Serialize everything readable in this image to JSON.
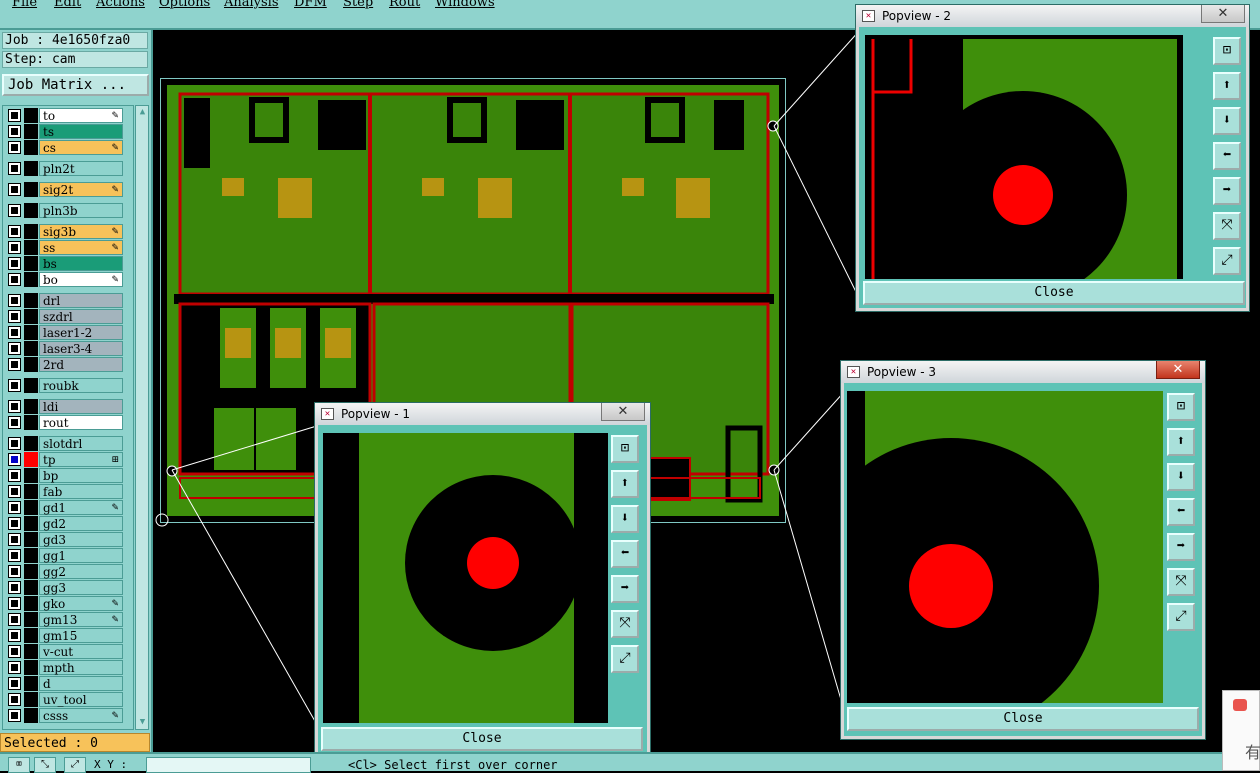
{
  "menu": [
    "File",
    "Edit",
    "Actions",
    "Options",
    "Analysis",
    "DFM",
    "Step",
    "Rout",
    "Windows"
  ],
  "job": {
    "job_line": "Job : 4e1650fza0",
    "step_line": "Step: cam",
    "matrix_button": "Job Matrix ..."
  },
  "layers": [
    {
      "name": "to",
      "bg": "#ffffff",
      "mark": "✎",
      "check": "off",
      "swatch": "#000000"
    },
    {
      "name": "ts",
      "bg": "#1a9c78",
      "mark": "",
      "check": "off",
      "swatch": "#000000"
    },
    {
      "name": "cs",
      "bg": "#f7c25a",
      "mark": "✎",
      "check": "off",
      "swatch": "#000000"
    },
    {
      "name": "pln2t",
      "bg": "#8fd3cd",
      "mark": "",
      "check": "off",
      "swatch": "#000000"
    },
    {
      "name": "sig2t",
      "bg": "#f7c25a",
      "mark": "✎",
      "check": "off",
      "swatch": "#000000"
    },
    {
      "name": "pln3b",
      "bg": "#8fd3cd",
      "mark": "",
      "check": "off",
      "swatch": "#000000"
    },
    {
      "name": "sig3b",
      "bg": "#f7c25a",
      "mark": "✎",
      "check": "off",
      "swatch": "#000000"
    },
    {
      "name": "ss",
      "bg": "#f7c25a",
      "mark": "✎",
      "check": "off",
      "swatch": "#000000"
    },
    {
      "name": "bs",
      "bg": "#1a9c78",
      "mark": "",
      "check": "off",
      "swatch": "#000000"
    },
    {
      "name": "bo",
      "bg": "#ffffff",
      "mark": "✎",
      "check": "off",
      "swatch": "#000000"
    },
    {
      "name": "drl",
      "bg": "#a3b4bd",
      "mark": "",
      "check": "off",
      "swatch": "#000000"
    },
    {
      "name": "szdrl",
      "bg": "#a3b4bd",
      "mark": "",
      "check": "off",
      "swatch": "#000000"
    },
    {
      "name": "laser1-2",
      "bg": "#a3b4bd",
      "mark": "",
      "check": "off",
      "swatch": "#000000"
    },
    {
      "name": "laser3-4",
      "bg": "#a3b4bd",
      "mark": "",
      "check": "off",
      "swatch": "#000000"
    },
    {
      "name": "2rd",
      "bg": "#a3b4bd",
      "mark": "",
      "check": "off",
      "swatch": "#000000"
    },
    {
      "name": "roubk",
      "bg": "#8fd3cd",
      "mark": "",
      "check": "off",
      "swatch": "#000000"
    },
    {
      "name": "ldi",
      "bg": "#a3b4bd",
      "mark": "",
      "check": "off",
      "swatch": "#000000"
    },
    {
      "name": "rout",
      "bg": "#ffffff",
      "mark": "",
      "check": "off",
      "swatch": "#000000"
    },
    {
      "name": "slotdrl",
      "bg": "#8fd3cd",
      "mark": "",
      "check": "off",
      "swatch": "#000000"
    },
    {
      "name": "tp",
      "bg": "#8fd3cd",
      "mark": "⊞",
      "check": "on",
      "swatch": "#ff0000"
    },
    {
      "name": "bp",
      "bg": "#8fd3cd",
      "mark": "",
      "check": "off",
      "swatch": "#000000"
    },
    {
      "name": "fab",
      "bg": "#8fd3cd",
      "mark": "",
      "check": "off",
      "swatch": "#000000"
    },
    {
      "name": "gd1",
      "bg": "#8fd3cd",
      "mark": "✎",
      "check": "off",
      "swatch": "#000000"
    },
    {
      "name": "gd2",
      "bg": "#8fd3cd",
      "mark": "",
      "check": "off",
      "swatch": "#000000"
    },
    {
      "name": "gd3",
      "bg": "#8fd3cd",
      "mark": "",
      "check": "off",
      "swatch": "#000000"
    },
    {
      "name": "gg1",
      "bg": "#8fd3cd",
      "mark": "",
      "check": "off",
      "swatch": "#000000"
    },
    {
      "name": "gg2",
      "bg": "#8fd3cd",
      "mark": "",
      "check": "off",
      "swatch": "#000000"
    },
    {
      "name": "gg3",
      "bg": "#8fd3cd",
      "mark": "",
      "check": "off",
      "swatch": "#000000"
    },
    {
      "name": "gko",
      "bg": "#8fd3cd",
      "mark": "✎",
      "check": "off",
      "swatch": "#000000"
    },
    {
      "name": "gm13",
      "bg": "#8fd3cd",
      "mark": "✎",
      "check": "off",
      "swatch": "#000000"
    },
    {
      "name": "gm15",
      "bg": "#8fd3cd",
      "mark": "",
      "check": "off",
      "swatch": "#000000"
    },
    {
      "name": "v-cut",
      "bg": "#8fd3cd",
      "mark": "",
      "check": "off",
      "swatch": "#000000"
    },
    {
      "name": "mpth",
      "bg": "#8fd3cd",
      "mark": "",
      "check": "off",
      "swatch": "#000000"
    },
    {
      "name": "d",
      "bg": "#8fd3cd",
      "mark": "",
      "check": "off",
      "swatch": "#000000"
    },
    {
      "name": "uv_tool",
      "bg": "#8fd3cd",
      "mark": "",
      "check": "off",
      "swatch": "#000000"
    },
    {
      "name": "csss",
      "bg": "#8fd3cd",
      "mark": "✎",
      "check": "off",
      "swatch": "#000000"
    }
  ],
  "selected_label": "Selected : 0",
  "popups": [
    {
      "title": "Popview - 1",
      "close_label": "Close",
      "close_x": "✕"
    },
    {
      "title": "Popview - 2",
      "close_label": "Close",
      "close_x": "✕"
    },
    {
      "title": "Popview - 3",
      "close_label": "Close",
      "close_x": "✕"
    }
  ],
  "popup_tools": [
    "zoom-window-icon",
    "pan-up-icon",
    "pan-down-icon",
    "pan-left-icon",
    "pan-right-icon",
    "zoom-out-icon",
    "zoom-in-icon"
  ],
  "popup_tool_glyphs": [
    "⊡",
    "⬆",
    "⬇",
    "⬅",
    "➡",
    "⤧",
    "⤢"
  ],
  "status": {
    "coord_label": "X Y :",
    "message": "<Cl>  Select first over corner",
    "button_glyphs": [
      "⌧",
      "⤡",
      "⤢"
    ]
  },
  "colors": {
    "board_green": "#3f8f0b",
    "trace_red": "#c00000",
    "pad_gold": "#b79412",
    "via_red": "#ff0000",
    "panel_teal": "#8fd3cd"
  }
}
